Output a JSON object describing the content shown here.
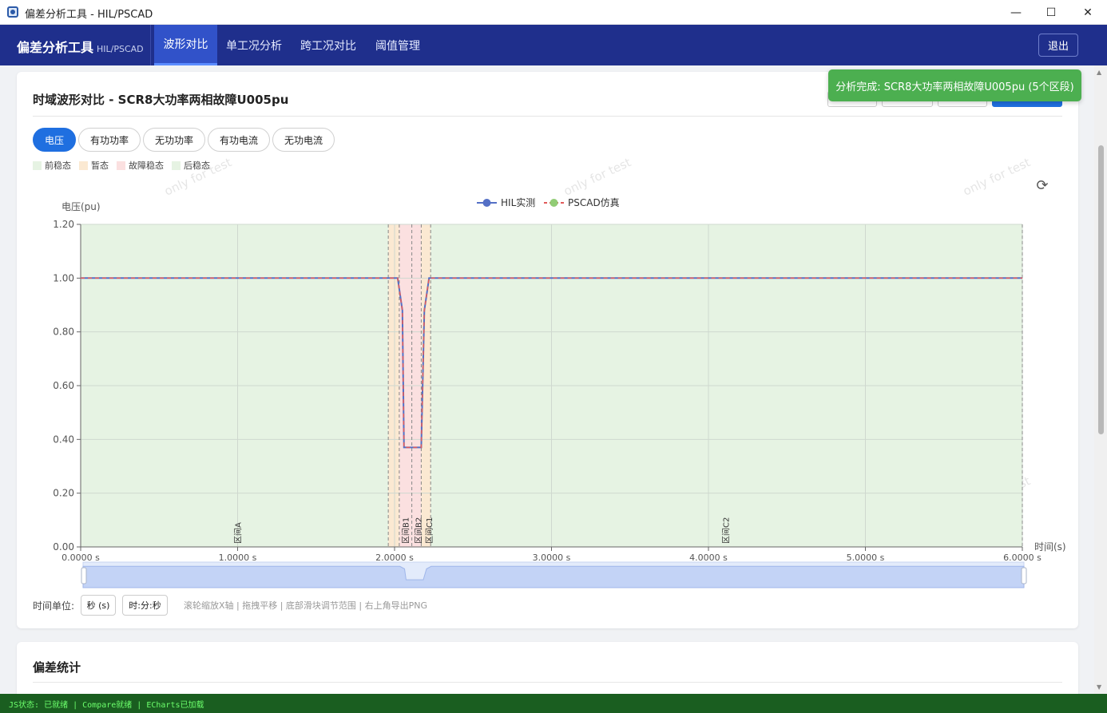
{
  "window": {
    "title": "偏差分析工具 - HIL/PSCAD",
    "min_icon": "minimize-icon",
    "max_icon": "maximize-icon",
    "close_icon": "close-icon"
  },
  "nav": {
    "brand": "偏差分析工具",
    "brand_sub": "HIL/PSCAD",
    "tabs": [
      {
        "label": "波形对比",
        "active": true
      },
      {
        "label": "单工况分析",
        "active": false
      },
      {
        "label": "跨工况对比",
        "active": false
      },
      {
        "label": "阈值管理",
        "active": false
      }
    ],
    "logout": "退出"
  },
  "toast": "分析完成: SCR8大功率两相故障U005pu (5个区段)",
  "waveform_card": {
    "title": "时域波形对比 - SCR8大功率两相故障U005pu",
    "signal_tabs": [
      {
        "label": "电压",
        "active": true
      },
      {
        "label": "有功功率",
        "active": false
      },
      {
        "label": "无功功率",
        "active": false
      },
      {
        "label": "有功电流",
        "active": false
      },
      {
        "label": "无功电流",
        "active": false
      }
    ],
    "phase_legend": [
      {
        "label": "前稳态",
        "color": "#e6f3e3"
      },
      {
        "label": "暂态",
        "color": "#fbe9d2"
      },
      {
        "label": "故障稳态",
        "color": "#fbe0e0"
      },
      {
        "label": "后稳态",
        "color": "#e6f3e3"
      }
    ],
    "watermark": "only for test",
    "time_unit_label": "时间单位:",
    "unit_seconds": "秒 (s)",
    "unit_hms": "时:分:秒",
    "hint": "滚轮缩放X轴 | 拖拽平移 | 底部滑块调节范围 | 右上角导出PNG"
  },
  "stats_card": {
    "title": "偏差统计"
  },
  "statusbar": "JS状态: 已就绪 | Compare就绪 | ECharts已加载",
  "chart_data": {
    "type": "line",
    "ylabel": "电压(pu)",
    "xlabel": "时间(s)",
    "xlim": [
      0,
      6
    ],
    "ylim": [
      0,
      1.2
    ],
    "yticks": [
      "0.00",
      "0.20",
      "0.40",
      "0.60",
      "0.80",
      "1.00",
      "1.20"
    ],
    "xticks": [
      "0.0000 s",
      "1.0000 s",
      "2.0000 s",
      "3.0000 s",
      "4.0000 s",
      "5.0000 s",
      "6.0000 s"
    ],
    "grid": true,
    "legend_position": "top-center",
    "series": [
      {
        "name": "HIL实测",
        "color": "#5470c6",
        "dashed": false,
        "x": [
          0,
          2.02,
          2.05,
          2.06,
          2.17,
          2.19,
          2.22,
          6
        ],
        "y": [
          1.0,
          1.0,
          0.88,
          0.37,
          0.37,
          0.88,
          1.0,
          1.0
        ]
      },
      {
        "name": "PSCAD仿真",
        "color": "#e15a5a",
        "marker_color": "#91cc75",
        "dashed": true,
        "x": [
          0,
          2.02,
          2.05,
          2.06,
          2.17,
          2.19,
          2.22,
          6
        ],
        "y": [
          1.0,
          1.0,
          0.88,
          0.37,
          0.37,
          0.88,
          1.0,
          1.0
        ]
      }
    ],
    "bands": [
      {
        "label": "前稳态",
        "from": 0,
        "to": 1.96,
        "color": "#e6f3e3"
      },
      {
        "label": "暂态",
        "from": 1.96,
        "to": 2.03,
        "color": "#fbe9d2"
      },
      {
        "label": "故障稳态",
        "from": 2.03,
        "to": 2.17,
        "color": "#fbe0e0"
      },
      {
        "label": "暂态",
        "from": 2.17,
        "to": 2.23,
        "color": "#fbe9d2"
      },
      {
        "label": "后稳态",
        "from": 2.23,
        "to": 6.0,
        "color": "#e6f3e3"
      }
    ],
    "segment_markers": [
      {
        "label": "区间A",
        "x": 1.02
      },
      {
        "label": "区间B1",
        "x": 2.09
      },
      {
        "label": "区间B2",
        "x": 2.17
      },
      {
        "label": "区间C1",
        "x": 2.24
      },
      {
        "label": "区间C2",
        "x": 4.13
      }
    ],
    "boundaries": [
      0,
      1.96,
      2.03,
      2.11,
      2.17,
      2.23,
      6.0
    ]
  }
}
